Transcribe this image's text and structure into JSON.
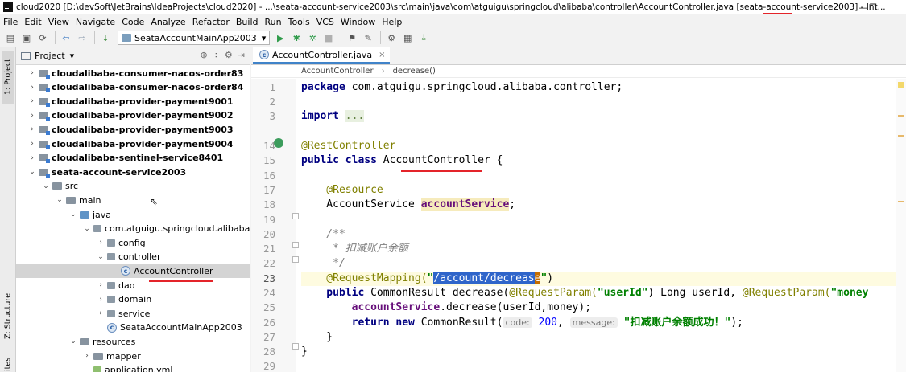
{
  "window": {
    "title": "cloud2020 [D:\\devSoft\\JetBrains\\IdeaProjects\\cloud2020] - ...\\seata-account-service2003\\src\\main\\java\\com\\atguigu\\springcloud\\alibaba\\controller\\AccountController.java [seata-account-service2003] - Int...",
    "restore_glyph": "❐",
    "minimize_glyph": "—"
  },
  "menu": [
    "File",
    "Edit",
    "View",
    "Navigate",
    "Code",
    "Analyze",
    "Refactor",
    "Build",
    "Run",
    "Tools",
    "VCS",
    "Window",
    "Help"
  ],
  "toolbar": {
    "run_config": "SeataAccountMainApp2003",
    "dropdown_glyph": "▾",
    "icons": [
      "▤",
      "▣",
      "⟳",
      "⇦",
      "⇨",
      "↓",
      "▶",
      "✱",
      "✲",
      "■",
      "⚑",
      "✎",
      "⚙",
      "▦",
      "⤓"
    ]
  },
  "left_strip": {
    "project_tab": "1: Project",
    "structure_tab": "Z: Structure",
    "other_tab": "ites"
  },
  "project_panel": {
    "title": "Project",
    "title_arrow": "▾",
    "tools": [
      "⊕",
      "÷",
      "⚙",
      "⇥"
    ],
    "tree": [
      {
        "label": "cloudalibaba-consumer-nacos-order83",
        "depth": 0,
        "arrow": "›",
        "icon": "module",
        "bold": true
      },
      {
        "label": "cloudalibaba-consumer-nacos-order84",
        "depth": 0,
        "arrow": "›",
        "icon": "module",
        "bold": true
      },
      {
        "label": "cloudalibaba-provider-payment9001",
        "depth": 0,
        "arrow": "›",
        "icon": "module",
        "bold": true
      },
      {
        "label": "cloudalibaba-provider-payment9002",
        "depth": 0,
        "arrow": "›",
        "icon": "module",
        "bold": true
      },
      {
        "label": "cloudalibaba-provider-payment9003",
        "depth": 0,
        "arrow": "›",
        "icon": "module",
        "bold": true
      },
      {
        "label": "cloudalibaba-provider-payment9004",
        "depth": 0,
        "arrow": "›",
        "icon": "module",
        "bold": true
      },
      {
        "label": "cloudalibaba-sentinel-service8401",
        "depth": 0,
        "arrow": "›",
        "icon": "module",
        "bold": true
      },
      {
        "label": "seata-account-service2003",
        "depth": 0,
        "arrow": "⌄",
        "icon": "module",
        "bold": true
      },
      {
        "label": "src",
        "depth": 1,
        "arrow": "⌄",
        "icon": "folder",
        "bold": false
      },
      {
        "label": "main",
        "depth": 2,
        "arrow": "⌄",
        "icon": "folder",
        "bold": false
      },
      {
        "label": "java",
        "depth": 3,
        "arrow": "⌄",
        "icon": "src",
        "bold": false
      },
      {
        "label": "com.atguigu.springcloud.alibaba",
        "depth": 4,
        "arrow": "⌄",
        "icon": "pkg",
        "bold": false
      },
      {
        "label": "config",
        "depth": 5,
        "arrow": "›",
        "icon": "pkg",
        "bold": false
      },
      {
        "label": "controller",
        "depth": 5,
        "arrow": "⌄",
        "icon": "pkg",
        "bold": false
      },
      {
        "label": "AccountController",
        "depth": 6,
        "arrow": "",
        "icon": "class",
        "bold": false,
        "selected": true
      },
      {
        "label": "dao",
        "depth": 5,
        "arrow": "›",
        "icon": "pkg",
        "bold": false
      },
      {
        "label": "domain",
        "depth": 5,
        "arrow": "›",
        "icon": "pkg",
        "bold": false
      },
      {
        "label": "service",
        "depth": 5,
        "arrow": "›",
        "icon": "pkg",
        "bold": false
      },
      {
        "label": "SeataAccountMainApp2003",
        "depth": 5,
        "arrow": "",
        "icon": "class",
        "bold": false
      },
      {
        "label": "resources",
        "depth": 3,
        "arrow": "⌄",
        "icon": "folder",
        "bold": false
      },
      {
        "label": "mapper",
        "depth": 4,
        "arrow": "›",
        "icon": "folder",
        "bold": false
      },
      {
        "label": "application.yml",
        "depth": 4,
        "arrow": "",
        "icon": "file",
        "bold": false
      }
    ],
    "class_glyph": "c"
  },
  "editor": {
    "tab_label": "AccountController.java",
    "tab_close": "×",
    "breadcrumb": [
      "AccountController",
      "decrease()"
    ],
    "breadcrumb_sep": "›",
    "line_numbers": [
      "1",
      "2",
      "3",
      "14",
      "15",
      "16",
      "17",
      "18",
      "19",
      "20",
      "21",
      "22",
      "23",
      "24",
      "25",
      "26",
      "27",
      "28",
      "29"
    ],
    "code": {
      "l1_kw": "package",
      "l1_rest": " com.atguigu.springcloud.alibaba.controller;",
      "l3_kw": "import",
      "l3_dots": "...",
      "l14_ann": "@RestController",
      "l15_kw": "public class",
      "l15_name": " AccountController {",
      "l17_ann": "    @Resource",
      "l18_type": "    AccountService ",
      "l18_field": "accountService",
      "l18_end": ";",
      "l20_cmt": "    /**",
      "l21_cmt": "     * 扣减账户余额",
      "l22_cmt": "     */",
      "l23_ann": "    @RequestMapping(",
      "l23_q1": "\"",
      "l23_sel": "/account/decreas",
      "l23_caret": "e",
      "l23_q2": "\"",
      "l23_end": ")",
      "l24_kw": "    public",
      "l24_a": " CommonResult decrease(",
      "l24_ann1": "@RequestParam(",
      "l24_str1": "\"userId\"",
      "l24_b": ") Long userId, ",
      "l24_ann2": "@RequestParam(",
      "l24_str2": "\"money",
      "l25_field": "        accountService",
      "l25_rest": ".decrease(userId,money);",
      "l26_kw1": "        return new",
      "l26_a": " CommonResult(",
      "l26_hint1": "code:",
      "l26_num": " 200",
      "l26_b": ", ",
      "l26_hint2": "message:",
      "l26_str": " \"扣减账户余额成功！\"",
      "l26_end": ");",
      "l27_brace": "    }",
      "l28_brace": "}"
    }
  },
  "cursor_glyph": "⇖"
}
